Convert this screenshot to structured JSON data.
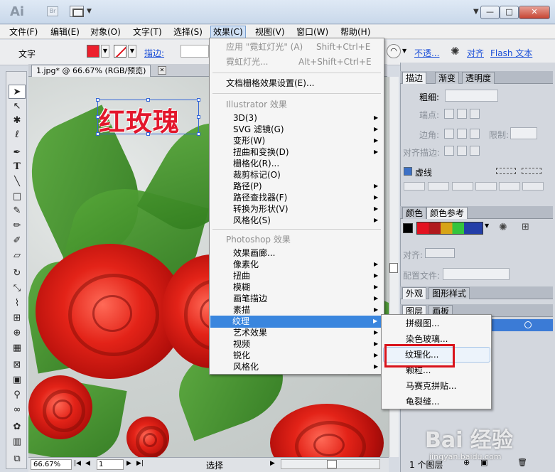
{
  "titlebar": {
    "logo": "Ai",
    "br": "Br"
  },
  "menubar": [
    {
      "label": "文件(F)"
    },
    {
      "label": "编辑(E)"
    },
    {
      "label": "对象(O)"
    },
    {
      "label": "文字(T)"
    },
    {
      "label": "选择(S)"
    },
    {
      "label": "效果(C)"
    },
    {
      "label": "视图(V)"
    },
    {
      "label": "窗口(W)"
    },
    {
      "label": "帮助(H)"
    }
  ],
  "control": {
    "mode": "文字",
    "stroke_label": "描边:",
    "opacity_label": "不透...",
    "align_label": "对齐",
    "flash_label": "Flash 文本"
  },
  "document": {
    "tab": "1.jpg* @ 66.67% (RGB/预览)",
    "text": "红玫瑰"
  },
  "status": {
    "zoom": "66.67%",
    "page": "1",
    "label": "选择"
  },
  "panels": {
    "stroke": {
      "tabs": [
        "描边",
        "渐变",
        "透明度"
      ],
      "weight": "粗细:",
      "cap": "端点:",
      "corner": "边角:",
      "limit": "限制:",
      "align": "对齐描边:",
      "dashed": "虚线"
    },
    "color": {
      "tabs": [
        "颜色",
        "颜色参考"
      ],
      "align_label": "对齐:",
      "profile_label": "配置文件:"
    },
    "appearance": {
      "tabs": [
        "外观",
        "图形样式"
      ]
    },
    "layers": {
      "tabs": [
        "图层",
        "画板"
      ],
      "count": "1 个图层"
    }
  },
  "effect_menu": {
    "apply": "应用 \"霓虹灯光\" (A)",
    "apply_sc": "Shift+Ctrl+E",
    "last": "霓虹灯光...",
    "last_sc": "Alt+Shift+Ctrl+E",
    "raster_settings": "文档栅格效果设置(E)...",
    "illustrator_header": "Illustrator 效果",
    "illustrator_items": [
      "3D(3)",
      "SVG 滤镜(G)",
      "变形(W)",
      "扭曲和变换(D)",
      "栅格化(R)...",
      "裁剪标记(O)",
      "路径(P)",
      "路径查找器(F)",
      "转换为形状(V)",
      "风格化(S)"
    ],
    "photoshop_header": "Photoshop 效果",
    "photoshop_items": [
      "效果画廊...",
      "像素化",
      "扭曲",
      "模糊",
      "画笔描边",
      "素描",
      "纹理",
      "艺术效果",
      "视频",
      "锐化",
      "风格化"
    ]
  },
  "texture_submenu": [
    "拼缀图...",
    "染色玻璃...",
    "纹理化...",
    "颗粒...",
    "马赛克拼贴...",
    "龟裂缝..."
  ],
  "watermark": {
    "brand": "Bai 经验",
    "url": "jingyan.baidu.com"
  }
}
